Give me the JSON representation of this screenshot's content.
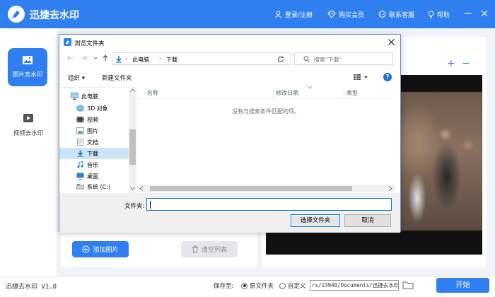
{
  "app": {
    "title": "迅捷去水印",
    "version": "迅捷去水印 V1.0",
    "accent": "#2f7ff0"
  },
  "header": {
    "login": "登录/注册",
    "vip": "购买会员",
    "service": "联系客服",
    "help": "帮助"
  },
  "sidebar": {
    "items": [
      {
        "label": "图片去水印",
        "icon": "image-icon",
        "active": true
      },
      {
        "label": "视频去水印",
        "icon": "video-play-icon",
        "active": false
      }
    ]
  },
  "left_panel": {
    "add_button": "添加图片",
    "clear_button": "清空列表"
  },
  "preview": {
    "zoom_in": "+",
    "zoom_out": "−"
  },
  "bottom": {
    "save_to": "保存至:",
    "option_original": "原文件夹",
    "option_custom": "自定义",
    "path": "rs/13940/Documents/迅捷去水印",
    "start_button": "开始"
  },
  "dialog": {
    "title": "浏览文件夹",
    "breadcrumb": [
      "此电脑",
      "下载"
    ],
    "search_placeholder": "搜索\"下载\"",
    "toolbar": {
      "organize": "组织 ▾",
      "new_folder": "新建文件夹",
      "help": "?"
    },
    "tree": [
      {
        "label": "此电脑",
        "icon": "computer-icon",
        "selected": false
      },
      {
        "label": "3D 对象",
        "icon": "3d-objects-icon",
        "selected": false
      },
      {
        "label": "视频",
        "icon": "videos-folder-icon",
        "selected": false
      },
      {
        "label": "图片",
        "icon": "pictures-folder-icon",
        "selected": false
      },
      {
        "label": "文档",
        "icon": "documents-folder-icon",
        "selected": false
      },
      {
        "label": "下载",
        "icon": "download-icon",
        "selected": true
      },
      {
        "label": "音乐",
        "icon": "music-icon",
        "selected": false
      },
      {
        "label": "桌面",
        "icon": "desktop-icon",
        "selected": false
      },
      {
        "label": "系统 (C:)",
        "icon": "drive-icon",
        "selected": false
      }
    ],
    "columns": [
      "名称",
      "修改日期",
      "类型"
    ],
    "empty_message": "没有与搜索条件匹配的项。",
    "filename_label": "文件夹:",
    "filename_value": "",
    "select_button": "选择文件夹",
    "cancel_button": "取消"
  }
}
